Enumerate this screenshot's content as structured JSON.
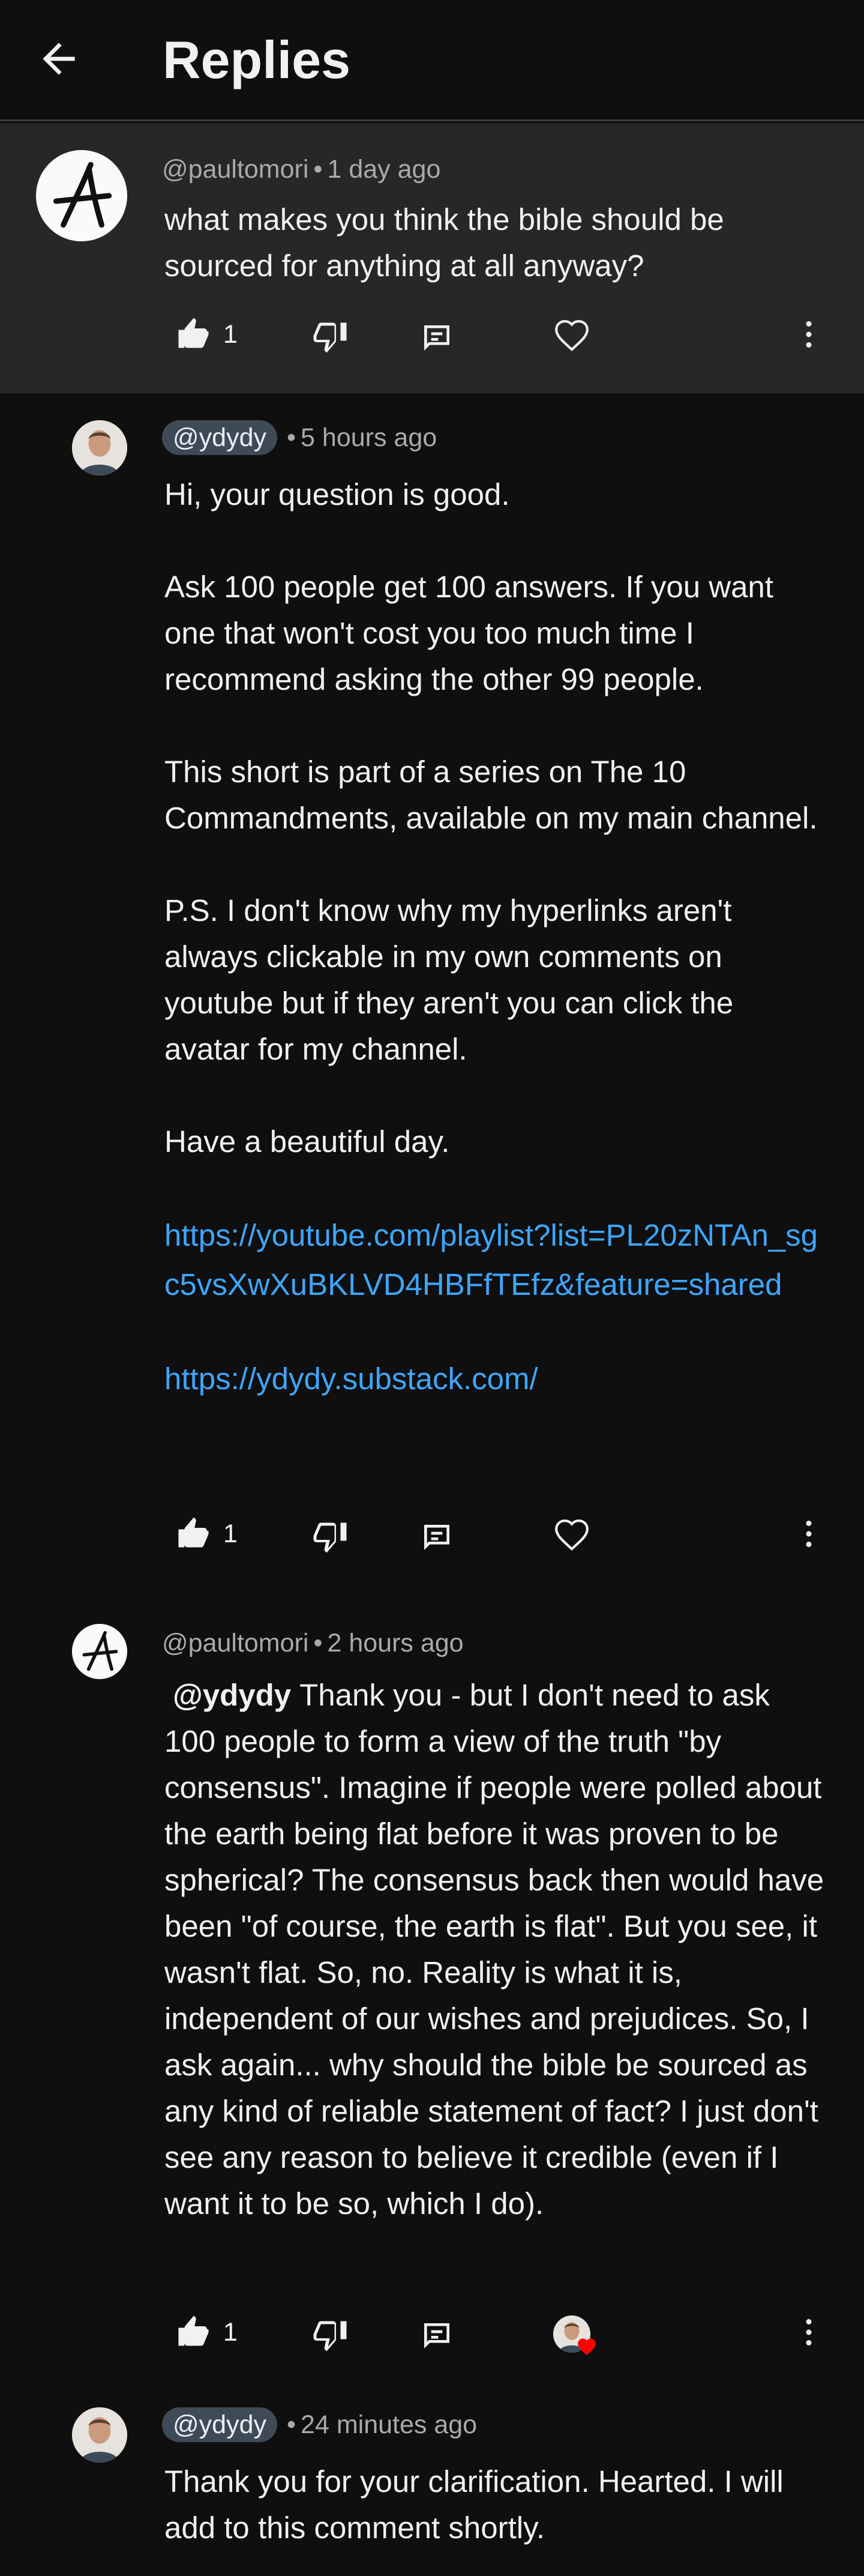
{
  "header": {
    "title": "Replies"
  },
  "comments": [
    {
      "author": "@paultomori",
      "time": "1 day ago",
      "body": "what makes you think the bible should be sourced for anything at all anyway?",
      "likes": "1"
    },
    {
      "author": "@ydydy",
      "time": "5 hours ago",
      "p1": "Hi, your question is good.",
      "p2": "Ask 100 people get 100 answers. If you want one that won't cost you too much time I recommend asking the other 99 people.",
      "p3": "This short is part of a series on The 10 Commandments, available on my main channel.",
      "p4": "P.S. I don't know why my hyperlinks aren't always clickable in my own comments on youtube but if they aren't you can click the avatar for my channel.",
      "p5": "Have a beautiful day.",
      "link1": "https://youtube.com/playlist?list=PL20zNTAn_sgc5vsXwXuBKLVD4HBFfTEfz&feature=shared",
      "link2": "https://ydydy.substack.com/",
      "likes": "1"
    },
    {
      "author": "@paultomori",
      "time": "2 hours ago",
      "mention": "@ydydy",
      "body": "Thank you - but I don't need to ask 100 people to form a view of the truth \"by consensus\".  Imagine if people were polled about the earth being flat before it was proven to be spherical?  The consensus back then would have been \"of course, the earth is flat\".  But you see, it wasn't flat.  So, no.  Reality is what it is, independent of our wishes and prejudices.  So, I ask again... why should the bible be sourced as any kind of reliable statement of fact?  I just don't see any reason to believe it credible (even if I want it to be so, which I do).",
      "likes": "1"
    },
    {
      "author": "@ydydy",
      "time": "24 minutes ago",
      "body": "Thank you for your clarification. Hearted. I will add to this comment shortly."
    }
  ],
  "colors": {
    "background": "#0f0f0f",
    "highlight": "#272727",
    "link": "#3ea6ff",
    "heart": "#ff0000"
  },
  "icons": [
    "back-arrow-icon",
    "like-icon",
    "dislike-icon",
    "reply-icon",
    "heart-icon",
    "more-vert-icon"
  ]
}
